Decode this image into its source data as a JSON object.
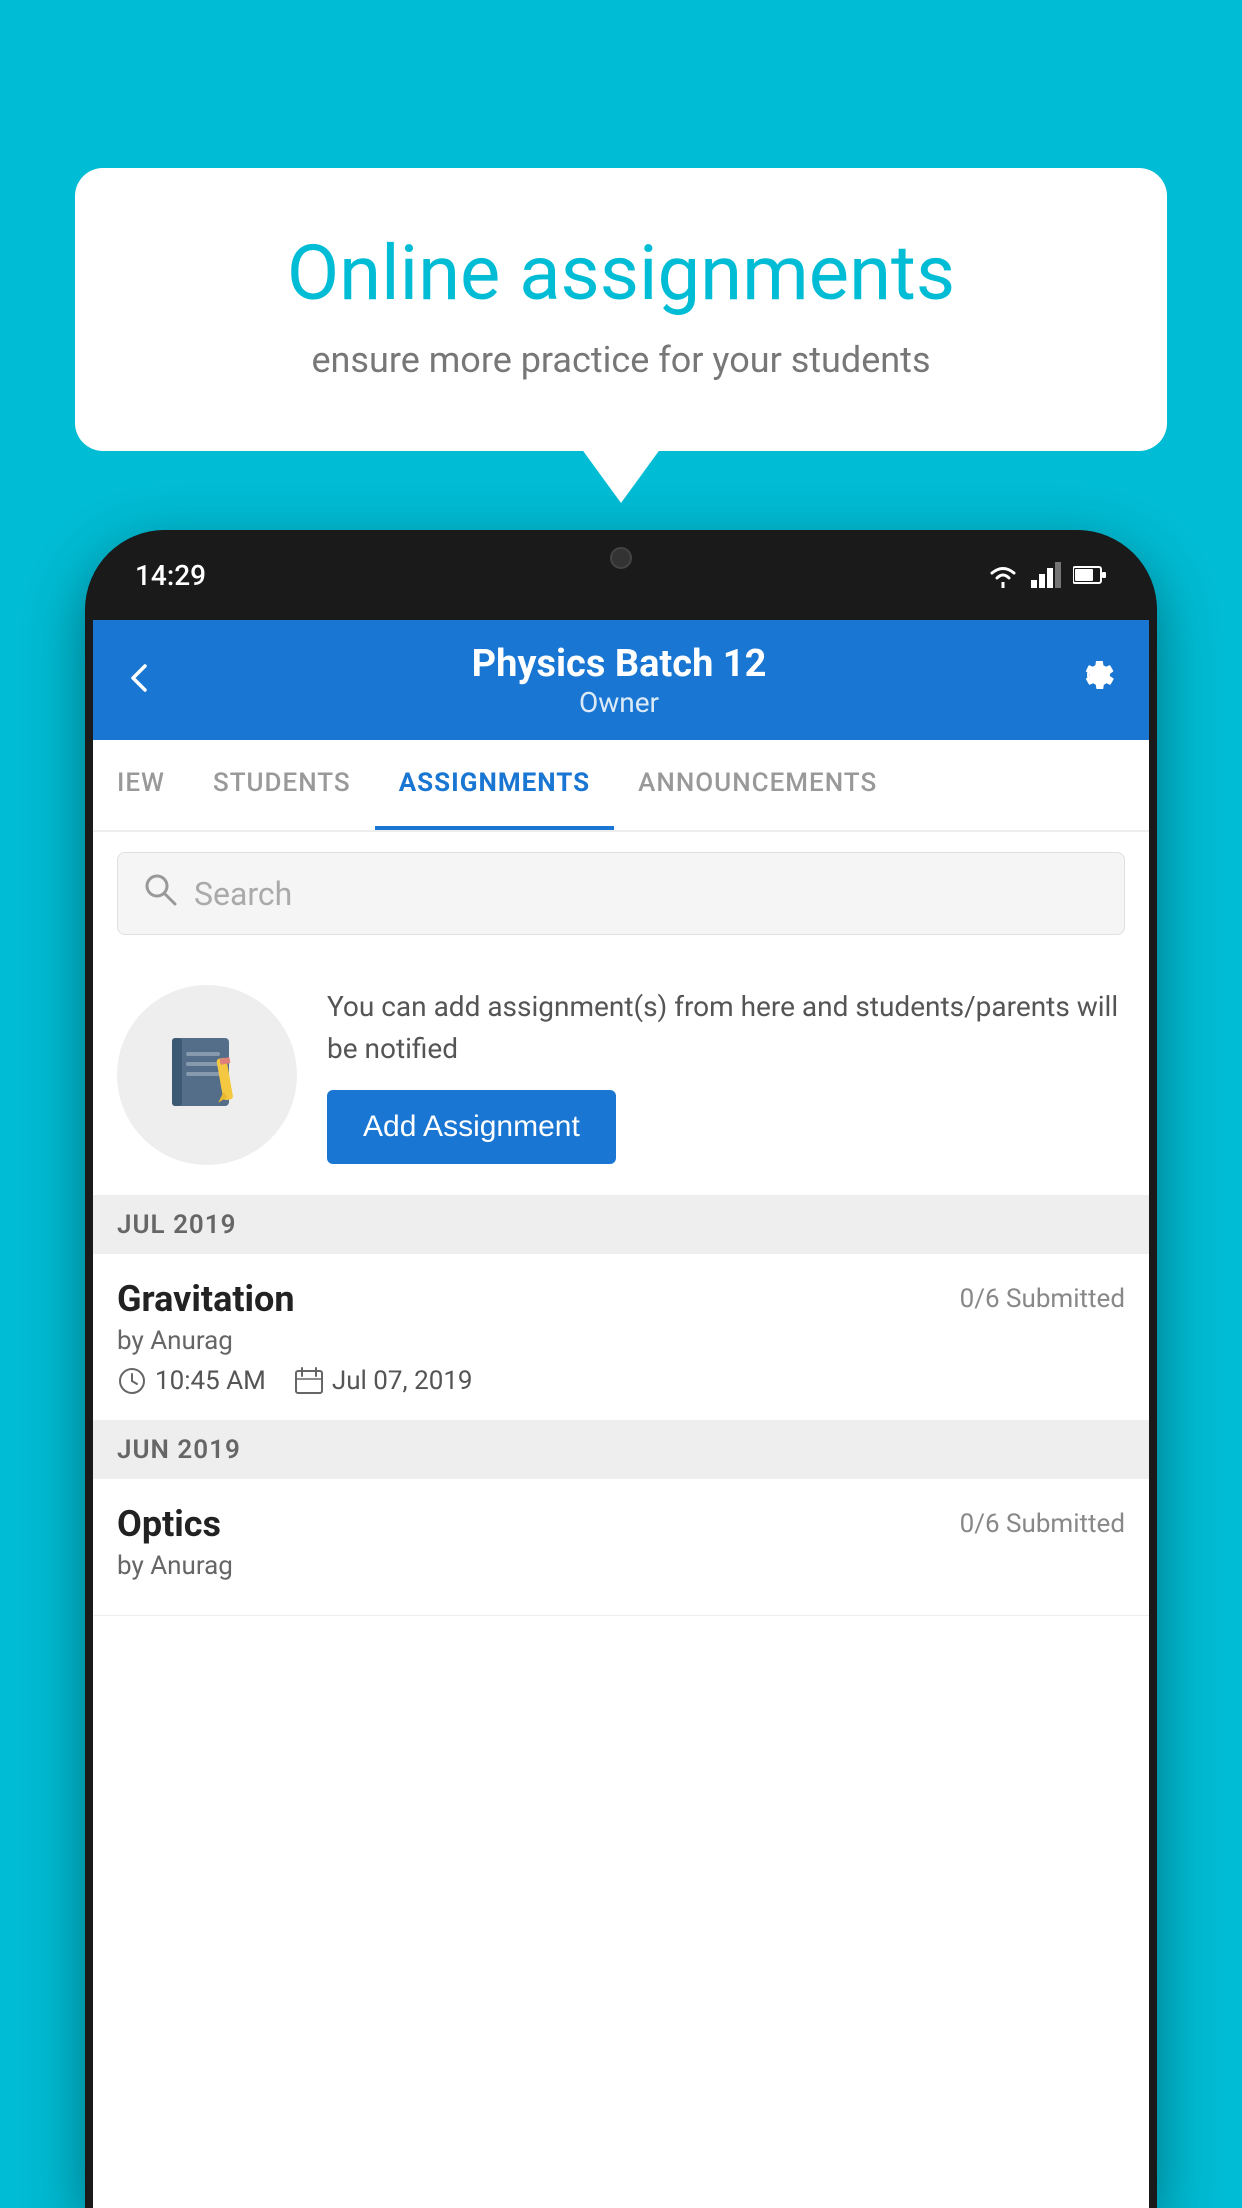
{
  "background_color": "#00bcd4",
  "bubble": {
    "title": "Online assignments",
    "subtitle": "ensure more practice for your students"
  },
  "status_bar": {
    "time": "14:29"
  },
  "app_bar": {
    "title": "Physics Batch 12",
    "subtitle": "Owner",
    "back_label": "←"
  },
  "tabs": [
    {
      "label": "IEW",
      "active": false
    },
    {
      "label": "STUDENTS",
      "active": false
    },
    {
      "label": "ASSIGNMENTS",
      "active": true
    },
    {
      "label": "ANNOUNCEMENTS",
      "active": false
    }
  ],
  "search": {
    "placeholder": "Search"
  },
  "promo": {
    "text": "You can add assignment(s) from here and students/parents will be notified",
    "button_label": "Add Assignment"
  },
  "sections": [
    {
      "label": "JUL 2019",
      "assignments": [
        {
          "name": "Gravitation",
          "submitted": "0/6 Submitted",
          "author": "by Anurag",
          "time": "10:45 AM",
          "date": "Jul 07, 2019"
        }
      ]
    },
    {
      "label": "JUN 2019",
      "assignments": [
        {
          "name": "Optics",
          "submitted": "0/6 Submitted",
          "author": "by Anurag",
          "time": "",
          "date": ""
        }
      ]
    }
  ]
}
